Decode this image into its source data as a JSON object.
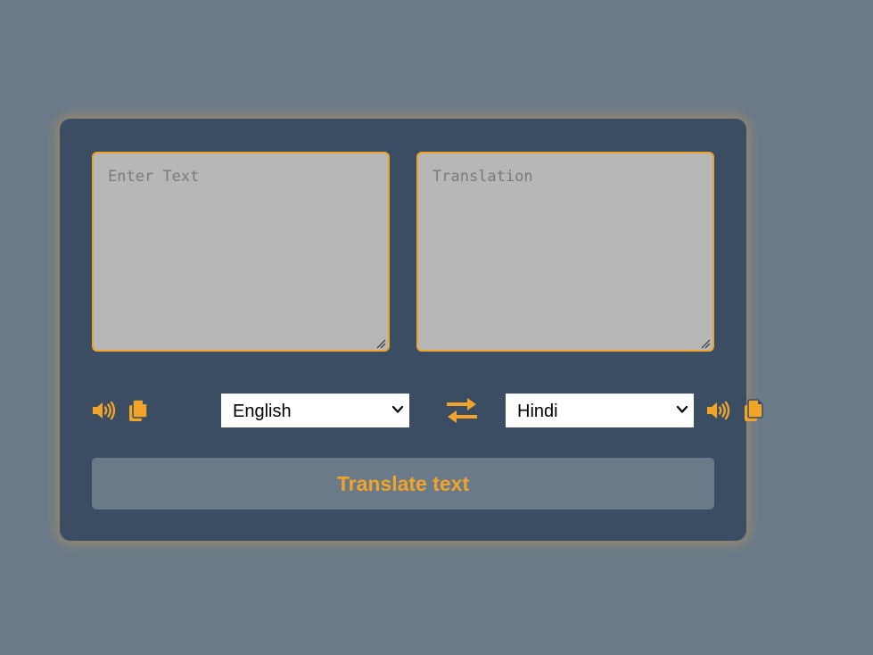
{
  "input": {
    "placeholder": "Enter Text",
    "value": ""
  },
  "output": {
    "placeholder": "Translation",
    "value": ""
  },
  "source_language": {
    "selected": "English",
    "icons": [
      "speaker-icon",
      "copy-icon"
    ]
  },
  "target_language": {
    "selected": "Hindi",
    "icons": [
      "speaker-icon",
      "copy-icon"
    ]
  },
  "swap": {
    "icon": "swap-arrows-icon"
  },
  "translate_button": {
    "label": "Translate text"
  },
  "colors": {
    "page_background": "#6b7a89",
    "card_background": "#3a4d63",
    "accent": "#f0a42a",
    "textarea_background": "#b7b7b7"
  }
}
